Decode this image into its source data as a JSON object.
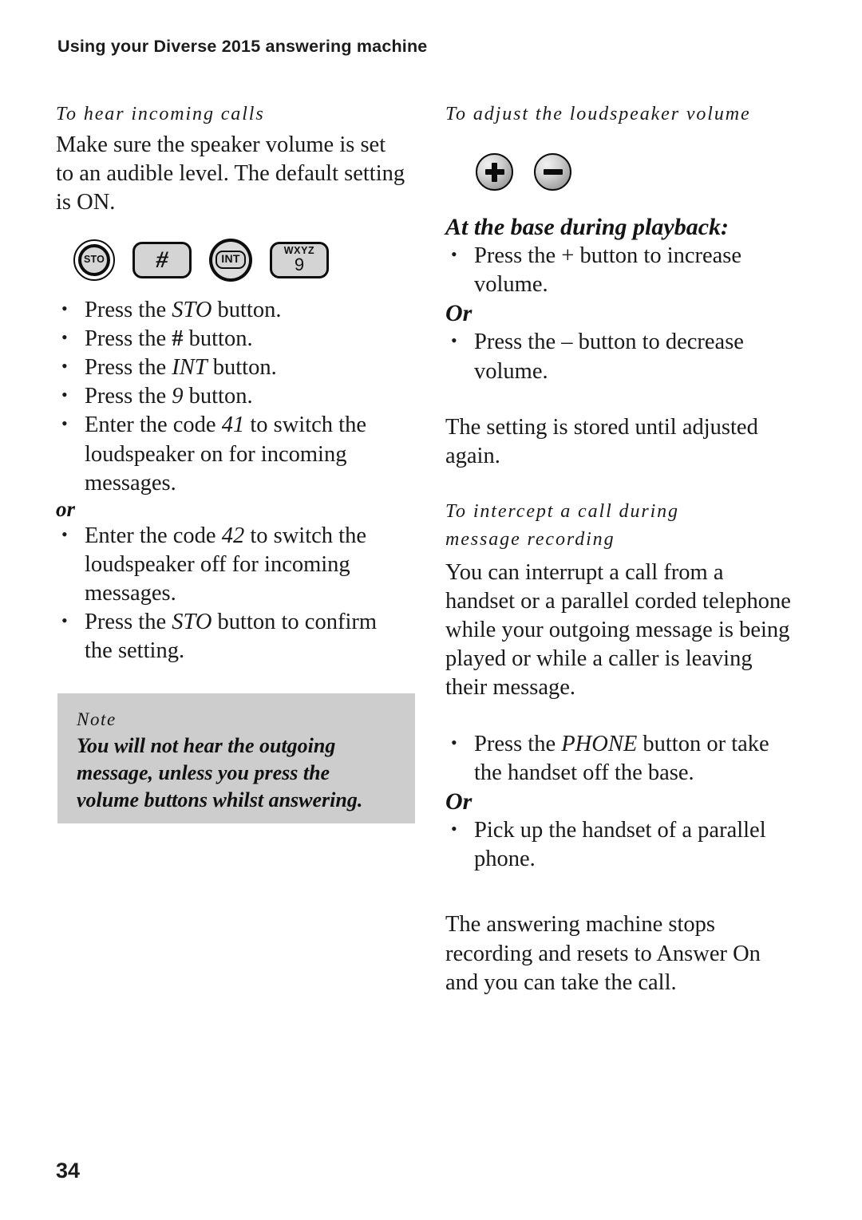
{
  "header": {
    "running_head": "Using your Diverse 2015 answering machine"
  },
  "left_column": {
    "heading": "To hear incoming calls",
    "intro": "Make sure the speaker volume is set to an audible level. The default setting is ON.",
    "keys": [
      {
        "name": "sto-key",
        "type": "round-ring",
        "label": "STO"
      },
      {
        "name": "hash-key",
        "type": "rect",
        "label": "#"
      },
      {
        "name": "int-key",
        "type": "circle-solid",
        "label": "INT"
      },
      {
        "name": "nine-key",
        "type": "rect-letters",
        "letters": "WXYZ",
        "digit": "9"
      }
    ],
    "steps": [
      {
        "pre": "Press the ",
        "em": "STO",
        "em_style": "italic",
        "post": " button."
      },
      {
        "pre": "Press the ",
        "em": "#",
        "em_style": "bold",
        "post": " button."
      },
      {
        "pre": "Press the ",
        "em": "INT",
        "em_style": "italic",
        "post": " button."
      },
      {
        "pre": "Press the ",
        "em": "9",
        "em_style": "italic",
        "post": " button."
      },
      {
        "pre": "Enter the code ",
        "em": "41",
        "em_style": "italic",
        "post": " to switch the loudspeaker on for incoming messages."
      }
    ],
    "or_label": "or",
    "steps_after_or": [
      {
        "pre": "Enter the code ",
        "em": "42",
        "em_style": "italic",
        "post": " to switch the loudspeaker off for incoming messages."
      },
      {
        "pre": "Press the ",
        "em": "STO",
        "em_style": "italic",
        "post": " button to confirm the setting."
      }
    ],
    "note": {
      "label": "Note",
      "text": "You will not hear the outgoing message, unless you press the volume buttons whilst answering.",
      "background_color": "#cdcdcd"
    }
  },
  "right_column": {
    "heading": "To adjust the loudspeaker volume",
    "volume_keys": [
      {
        "name": "volume-up-key",
        "glyph": "plus"
      },
      {
        "name": "volume-down-key",
        "glyph": "minus"
      }
    ],
    "playback_heading": "At the base during playback:",
    "playback_step_increase": "Press the + button to increase volume.",
    "or_label": "Or",
    "playback_step_decrease": "Press the – button to decrease volume.",
    "stored_text": "The setting is stored until adjusted again.",
    "intercept_heading_line1": "To intercept a call during",
    "intercept_heading_line2": "message recording",
    "intercept_body": "You can interrupt a call from a handset or a parallel corded telephone while your outgoing message is being played or while a caller is leaving their message.",
    "intercept_step_phone": {
      "pre": "Press the ",
      "em": "PHONE",
      "post": " button or take the handset off the base."
    },
    "or_label_2": "Or",
    "intercept_step_pickup": "Pick up the handset of a parallel phone.",
    "closing_text": "The answering machine stops recording and resets to Answer On and you can take the call."
  },
  "footer": {
    "page_number": "34"
  }
}
